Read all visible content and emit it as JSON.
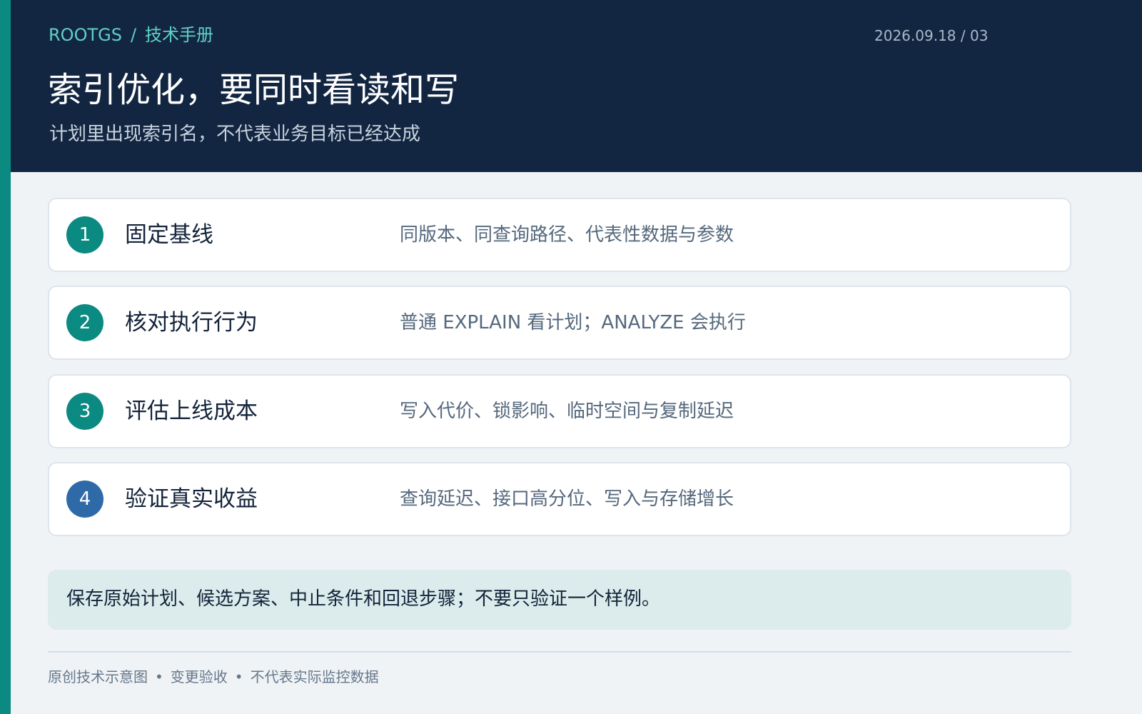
{
  "header": {
    "brand": "ROOTGS",
    "separator": "/",
    "section": "技术手册",
    "date_page": "2026.09.18 / 03",
    "title": "索引优化，要同时看读和写",
    "subtitle": "计划里出现索引名，不代表业务目标已经达成"
  },
  "steps": [
    {
      "number": "1",
      "title": "固定基线",
      "description": "同版本、同查询路径、代表性数据与参数"
    },
    {
      "number": "2",
      "title": "核对执行行为",
      "description": "普通 EXPLAIN 看计划；ANALYZE 会执行"
    },
    {
      "number": "3",
      "title": "评估上线成本",
      "description": "写入代价、锁影响、临时空间与复制延迟"
    },
    {
      "number": "4",
      "title": "验证真实收益",
      "description": "查询延迟、接口高分位、写入与存储增长"
    }
  ],
  "note": "保存原始计划、候选方案、中止条件和回退步骤；不要只验证一个样例。",
  "footer": {
    "items": [
      "原创技术示意图",
      "变更验收",
      "不代表实际监控数据"
    ],
    "separator": "•"
  },
  "colors": {
    "header_bg": "#132641",
    "accent_teal": "#0b8a82",
    "accent_blue": "#2e6aa8",
    "breadcrumb_text": "#5fd0c5",
    "page_bg": "#eff3f6",
    "note_bg": "#dcebeb"
  }
}
